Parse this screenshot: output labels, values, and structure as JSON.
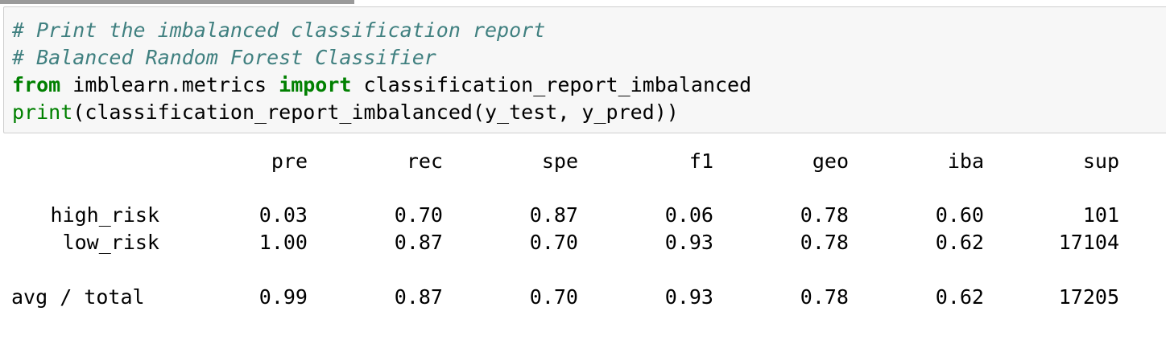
{
  "code": {
    "line1": "# Print the imbalanced classification report",
    "line2": "# Balanced Random Forest Classifier",
    "line3": {
      "kw_from": "from",
      "module": " imblearn.metrics ",
      "kw_import": "import",
      "name": " classification_report_imbalanced"
    },
    "line4": {
      "builtin": "print",
      "rest": "(classification_report_imbalanced(y_test, y_pred))"
    }
  },
  "report": {
    "headers": [
      "pre",
      "rec",
      "spe",
      "f1",
      "geo",
      "iba",
      "sup"
    ],
    "rows": [
      {
        "label": "high_risk",
        "values": [
          "0.03",
          "0.70",
          "0.87",
          "0.06",
          "0.78",
          "0.60",
          "101"
        ]
      },
      {
        "label": "low_risk",
        "values": [
          "1.00",
          "0.87",
          "0.70",
          "0.93",
          "0.78",
          "0.62",
          "17104"
        ]
      },
      {
        "label": "avg / total",
        "values": [
          "0.99",
          "0.87",
          "0.70",
          "0.93",
          "0.78",
          "0.62",
          "17205"
        ]
      }
    ]
  },
  "colors": {
    "comment": "#408080",
    "keyword": "#008000",
    "cell_background": "#f7f7f7",
    "cell_border": "#cfcfcf"
  }
}
